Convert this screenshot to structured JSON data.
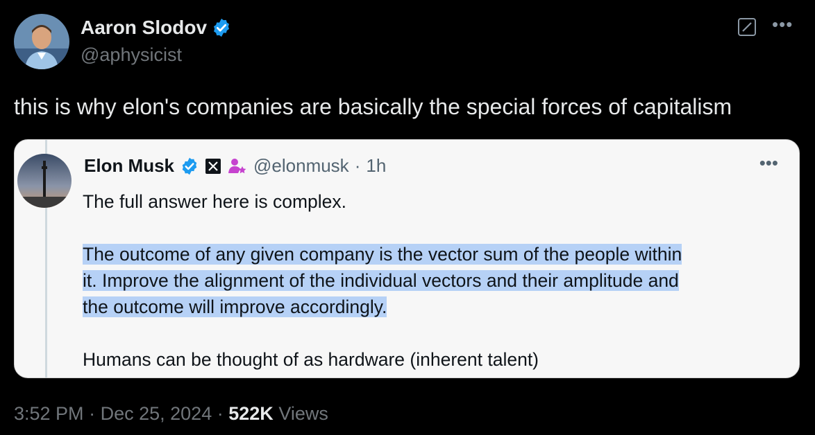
{
  "author": {
    "name": "Aaron Slodov",
    "handle": "@aphysicist"
  },
  "tweet": {
    "text": "this is why elon's companies are basically the special forces of capitalism"
  },
  "quote": {
    "name": "Elon Musk",
    "handle": "@elonmusk",
    "sep": "·",
    "time": "1h",
    "line1": "The full answer here is complex.",
    "highlight": [
      "The outcome of any given company is the vector sum of the people within",
      "it. Improve the alignment of the individual vectors and their amplitude and",
      "the outcome will improve accordingly."
    ],
    "line_last": "Humans can be thought of as hardware (inherent talent)"
  },
  "meta": {
    "time": "3:52 PM",
    "sep1": "·",
    "date": "Dec 25, 2024",
    "sep2": "·",
    "views_count": "522K",
    "views_label": "Views"
  },
  "icons": {
    "verified": "verified-badge-icon",
    "edit": "edit-icon",
    "more": "more-icon",
    "x_logo": "x-logo-icon",
    "affiliate": "affiliate-icon"
  },
  "colors": {
    "verified": "#1d9bf0",
    "highlight": "#b6d1f6",
    "affiliate": "#c643cf"
  }
}
